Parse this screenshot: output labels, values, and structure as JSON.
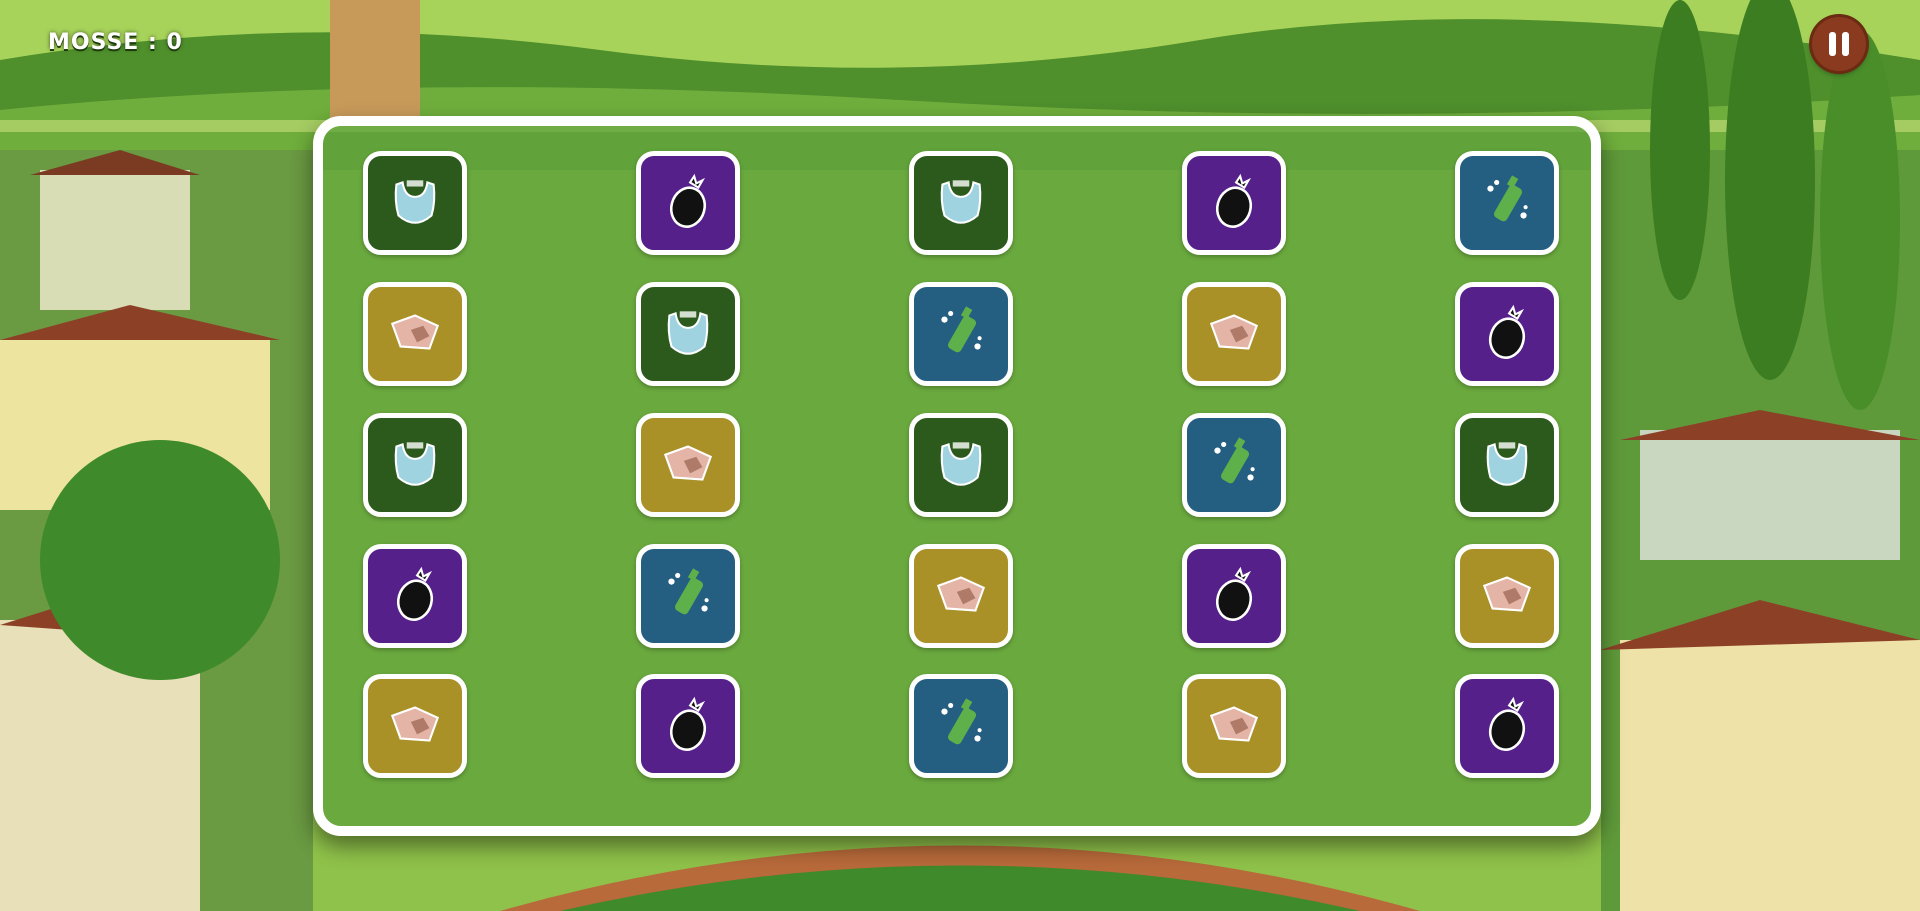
{
  "hud": {
    "moves_label": "MOSSE : 0"
  },
  "pause_button": {
    "icon": "pause-icon"
  },
  "colors": {
    "bag": "#2b5a1c",
    "seed": "#55208a",
    "bottle": "#245f82",
    "paper": "#a99128"
  },
  "board": {
    "rows": [
      [
        "bag",
        "seed",
        "bag",
        "seed",
        "bottle"
      ],
      [
        "paper",
        "bag",
        "bottle",
        "paper",
        "seed"
      ],
      [
        "bag",
        "paper",
        "bag",
        "bottle",
        "bag"
      ],
      [
        "seed",
        "bottle",
        "paper",
        "seed",
        "paper"
      ],
      [
        "paper",
        "seed",
        "bottle",
        "paper",
        "seed"
      ]
    ]
  }
}
